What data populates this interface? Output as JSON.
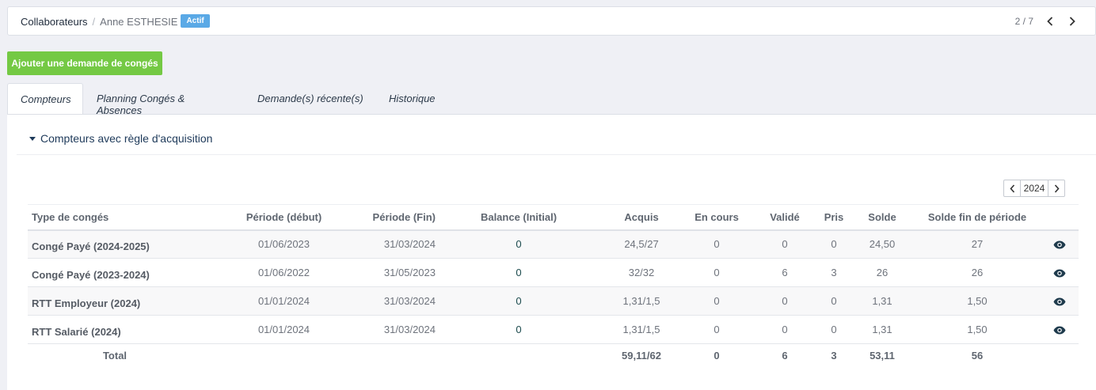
{
  "breadcrumb": {
    "root": "Collaborateurs",
    "current": "Anne ESTHESIE",
    "status_badge": "Actif"
  },
  "pager": {
    "position": "2 / 7"
  },
  "add_button_label": "Ajouter une demande de congés",
  "tabs": [
    {
      "label": "Compteurs",
      "active": true
    },
    {
      "label": "Planning Congés & Absences",
      "active": false
    },
    {
      "label": "Demande(s) récente(s)",
      "active": false
    },
    {
      "label": "Historique",
      "active": false
    }
  ],
  "section": {
    "title": "Compteurs avec règle d'acquisition"
  },
  "year_selector": {
    "year": "2024"
  },
  "table": {
    "headers": {
      "type": "Type de congés",
      "debut": "Période (début)",
      "fin": "Période (Fin)",
      "balance": "Balance (Initial)",
      "acquis": "Acquis",
      "encours": "En cours",
      "valide": "Validé",
      "pris": "Pris",
      "solde": "Solde",
      "solde_fin": "Solde fin de période"
    },
    "rows": [
      {
        "type": "Congé Payé (2024-2025)",
        "debut": "01/06/2023",
        "fin": "31/03/2024",
        "balance": "0",
        "acquis": "24,5/27",
        "encours": "0",
        "valide": "0",
        "pris": "0",
        "solde": "24,50",
        "solde_fin": "27"
      },
      {
        "type": "Congé Payé (2023-2024)",
        "debut": "01/06/2022",
        "fin": "31/05/2023",
        "balance": "0",
        "acquis": "32/32",
        "encours": "0",
        "valide": "6",
        "pris": "3",
        "solde": "26",
        "solde_fin": "26"
      },
      {
        "type": "RTT Employeur (2024)",
        "debut": "01/01/2024",
        "fin": "31/03/2024",
        "balance": "0",
        "acquis": "1,31/1,5",
        "encours": "0",
        "valide": "0",
        "pris": "0",
        "solde": "1,31",
        "solde_fin": "1,50"
      },
      {
        "type": "RTT Salarié (2024)",
        "debut": "01/01/2024",
        "fin": "31/03/2024",
        "balance": "0",
        "acquis": "1,31/1,5",
        "encours": "0",
        "valide": "0",
        "pris": "0",
        "solde": "1,31",
        "solde_fin": "1,50"
      }
    ],
    "total": {
      "label": "Total",
      "acquis": "59,11/62",
      "encours": "0",
      "valide": "6",
      "pris": "3",
      "solde": "53,11",
      "solde_fin": "56"
    }
  },
  "colors": {
    "badge": "#5aa9e6",
    "add_button": "#74c944",
    "eye_icon": "#1f3b4d"
  }
}
